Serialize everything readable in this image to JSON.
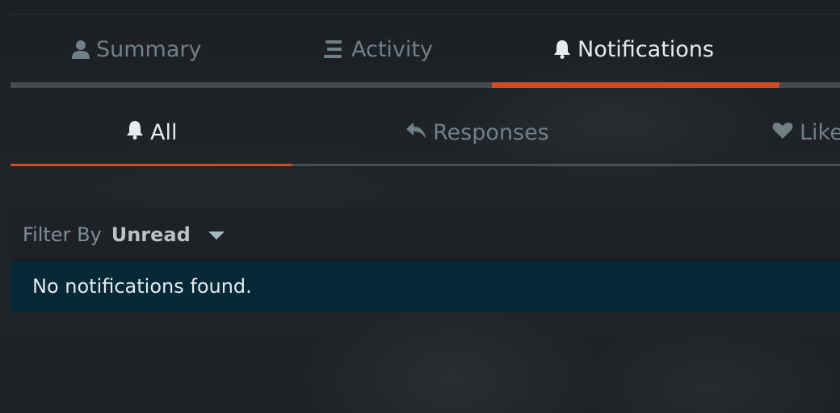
{
  "main_tabs": [
    {
      "label": "Summary",
      "icon": "user-icon"
    },
    {
      "label": "Activity",
      "icon": "list-icon"
    },
    {
      "label": "Notifications",
      "icon": "bell-icon",
      "active": true
    }
  ],
  "sub_tabs": [
    {
      "label": "All",
      "icon": "bell-icon",
      "active": true
    },
    {
      "label": "Responses",
      "icon": "reply-icon"
    },
    {
      "label": "Like",
      "icon": "heart-icon"
    }
  ],
  "filter": {
    "label": "Filter By",
    "value": "Unread"
  },
  "empty_message": "No notifications found.",
  "colors": {
    "accent": "#cf4a26",
    "background": "#1d2126",
    "inactive_text": "#6f8089",
    "active_text": "#e8ebee",
    "empty_row_bg": "#062837"
  }
}
